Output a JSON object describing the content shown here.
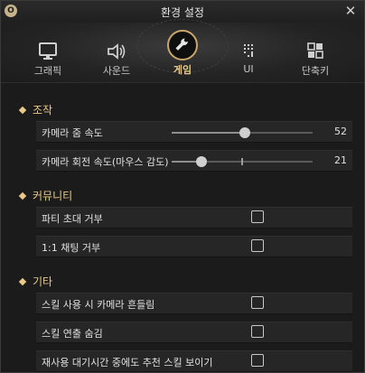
{
  "window": {
    "title": "환경 설정",
    "badge": "O",
    "close_glyph": "✕"
  },
  "tabs": [
    {
      "label": "그래픽",
      "icon": "monitor-icon"
    },
    {
      "label": "사운드",
      "icon": "speaker-icon"
    },
    {
      "label": "게임",
      "icon": "wrench-icon",
      "active": true
    },
    {
      "label": "UI",
      "icon": "ui-grid-icon"
    },
    {
      "label": "단축키",
      "icon": "shortcut-icon"
    }
  ],
  "sections": {
    "control": {
      "title": "조작",
      "camera_zoom": {
        "label": "카메라 줌 속도",
        "value": "52",
        "level": 0.52
      },
      "camera_rotate": {
        "label": "카메라 회전 속도(마우스 감도)",
        "value": "21",
        "level": 0.21
      }
    },
    "community": {
      "title": "커뮤니티",
      "party_invite": {
        "label": "파티 초대 거부",
        "checked": false
      },
      "chat_1on1": {
        "label": "1:1 채팅 거부",
        "checked": false
      }
    },
    "misc": {
      "title": "기타",
      "skill_shake": {
        "label": "스킬 사용 시 카메라 흔들림",
        "checked": false
      },
      "skill_hide": {
        "label": "스킬 연출 숨김",
        "checked": false
      },
      "recommend_skill": {
        "label": "재사용 대기시간 중에도 추천 스킬 보이기",
        "checked": false
      }
    }
  },
  "colors": {
    "accent": "#e8c98a",
    "ring": "#c9a66b",
    "row_bg": "#262626"
  }
}
